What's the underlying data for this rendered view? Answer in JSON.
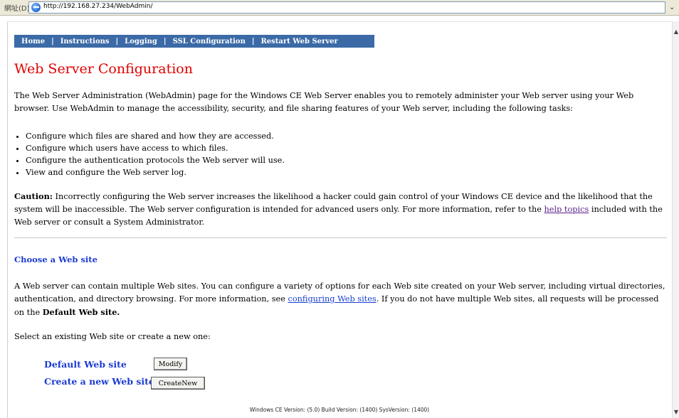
{
  "browser": {
    "address_label": "網址(D)",
    "url": "http://192.168.27.234/WebAdmin/",
    "dropdown_glyph": "⌄"
  },
  "nav": {
    "items": [
      "Home",
      "Instructions",
      "Logging",
      "SSL Configuration",
      "Restart Web Server"
    ],
    "separator": "|"
  },
  "page": {
    "title": "Web Server Configuration",
    "intro": "The Web Server Administration (WebAdmin) page for the Windows CE Web Server enables you to remotely administer your Web server using your Web browser. Use WebAdmin to manage the accessibility, security, and file sharing features of your Web server, including the following tasks:",
    "tasks": [
      "Configure which files are shared and how they are accessed.",
      "Configure which users have access to which files.",
      "Configure the authentication protocols the Web server will use.",
      "View and configure the Web server log."
    ],
    "caution_label": "Caution:",
    "caution_text_1": " Incorrectly configuring the Web server increases the likelihood a hacker could gain control of your Windows CE device and the likelihood that the system will be inaccessible. The Web server configuration is intended for advanced users only. For more information, refer to the ",
    "caution_link": "help topics",
    "caution_text_2": " included with the Web server or consult a System Administrator.",
    "section_title": "Choose a Web site",
    "section_text_1": "A Web server can contain multiple Web sites. You can configure a variety of options for each Web site created on your Web server, including virtual directories, authentication, and directory browsing. For more information, see ",
    "section_link": "configuring Web sites",
    "section_text_2": ". If you do not have multiple Web sites, all requests will be processed on the ",
    "section_bold": "Default Web site.",
    "select_prompt": "Select an existing Web site or create a new one:",
    "default_site_label": "Default Web site",
    "modify_button": "Modify",
    "create_site_label": "Create a new Web site",
    "create_button": "CreateNew",
    "footer": "Windows CE Version: (5.0) Build Version: (1400) SysVersion: (1400)"
  }
}
